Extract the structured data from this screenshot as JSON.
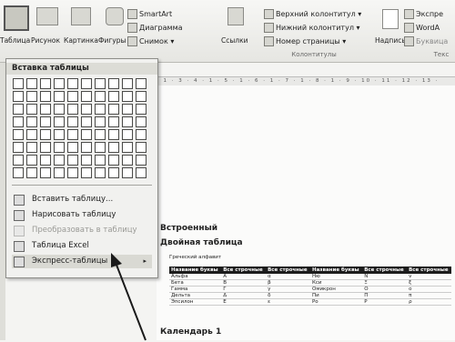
{
  "ribbon": {
    "table": "Таблица",
    "picture": "Рисунок",
    "clipart": "Картинка",
    "shapes": "Фигуры",
    "smartart": "SmartArt",
    "chart": "Диаграмма",
    "screenshot": "Снимок",
    "links": "Ссылки",
    "header": "Верхний колонтитул",
    "footer": "Нижний колонтитул",
    "page_number": "Номер страницы",
    "textbox": "Надпись",
    "express": "Экспре",
    "wordart": "WordA",
    "dropcap": "Буквица",
    "group_headers": "Колонтитулы",
    "group_text": "Текс"
  },
  "ruler_text": "· 1 · 3 · 4 · 1 · 5 · 1 · 6 · 1 · 7 · 1 · 8 · 1 · 9 · 10 · 11 · 12 · 13 ·",
  "menu": {
    "title": "Вставка таблицы",
    "items": [
      {
        "label": "Вставить таблицу...",
        "disabled": false,
        "submenu": false
      },
      {
        "label": "Нарисовать таблицу",
        "disabled": false,
        "submenu": false
      },
      {
        "label": "Преобразовать в таблицу",
        "disabled": true,
        "submenu": false
      },
      {
        "label": "Таблица Excel",
        "disabled": false,
        "submenu": false
      },
      {
        "label": "Экспресс-таблицы",
        "disabled": false,
        "submenu": true
      }
    ]
  },
  "document": {
    "line1": "Встроенный",
    "line2": "Двойная таблица",
    "caption": "Греческий алфавит",
    "table_headers": [
      "Название буквы",
      "Все строчные",
      "Все строчные",
      "Название буквы",
      "Все строчные",
      "Все строчные"
    ],
    "table_rows": [
      [
        "Альфа",
        "А",
        "α",
        "Ню",
        "Ν",
        "ν"
      ],
      [
        "Бета",
        "В",
        "β",
        "Кси",
        "Ξ",
        "ξ"
      ],
      [
        "Гамма",
        "Г",
        "γ",
        "Омикрон",
        "Ο",
        "ο"
      ],
      [
        "Дельта",
        "Δ",
        "δ",
        "Пи",
        "Π",
        "π"
      ],
      [
        "Эпсилон",
        "Е",
        "ε",
        "Ро",
        "Ρ",
        "ρ"
      ]
    ],
    "calendar": "Календарь 1"
  },
  "colors": {
    "table_header_bg": "#1c1c1c",
    "menu_bg": "#f1f1ef"
  }
}
